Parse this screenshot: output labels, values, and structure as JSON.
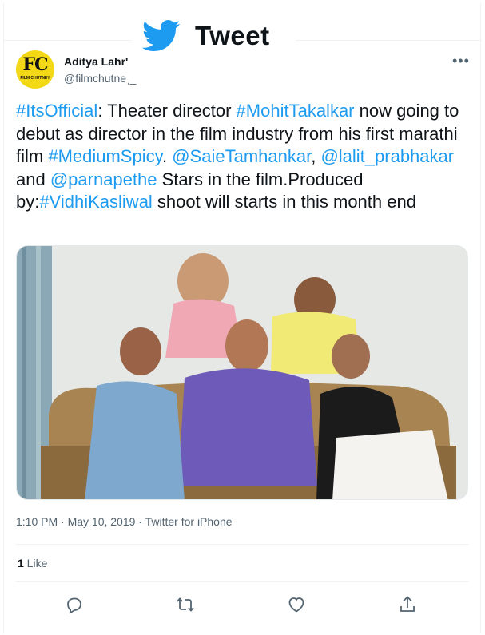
{
  "header": {
    "title": "Tweet"
  },
  "author": {
    "avatar_text": "FC",
    "avatar_subtext": "FILM CHUTNEY",
    "display_name": "Aditya Lahr'",
    "handle": "@filmchutneˌ_"
  },
  "tweet": {
    "segments": [
      {
        "text": "#ItsOfficial",
        "link": true
      },
      {
        "text": ": Theater director  ",
        "link": false
      },
      {
        "text": "#MohitTakalkar",
        "link": true
      },
      {
        "text": " now going to debut as director in the film industry from his first marathi film ",
        "link": false
      },
      {
        "text": "#MediumSpicy",
        "link": true
      },
      {
        "text": ". ",
        "link": false
      },
      {
        "text": "@SaieTamhankar",
        "link": true
      },
      {
        "text": ", ",
        "link": false
      },
      {
        "text": "@lalit_prabhakar",
        "link": true
      },
      {
        "text": " and ",
        "link": false
      },
      {
        "text": "@parnapethe",
        "link": true
      },
      {
        "text": " Stars in the film.Produced by:",
        "link": false
      },
      {
        "text": "#VidhiKasliwal",
        "link": true
      },
      {
        "text": " shoot will starts in this month end",
        "link": false
      }
    ],
    "meta": "1:10 PM · May 10, 2019 · Twitter for iPhone",
    "like_count": "1",
    "like_label": " Like"
  },
  "actions": [
    {
      "name": "reply-icon"
    },
    {
      "name": "retweet-icon"
    },
    {
      "name": "like-icon"
    },
    {
      "name": "share-icon"
    }
  ],
  "colors": {
    "accent": "#1d9bf0",
    "text": "#0f1419",
    "muted": "#536471",
    "avatar": "#f3d816"
  }
}
